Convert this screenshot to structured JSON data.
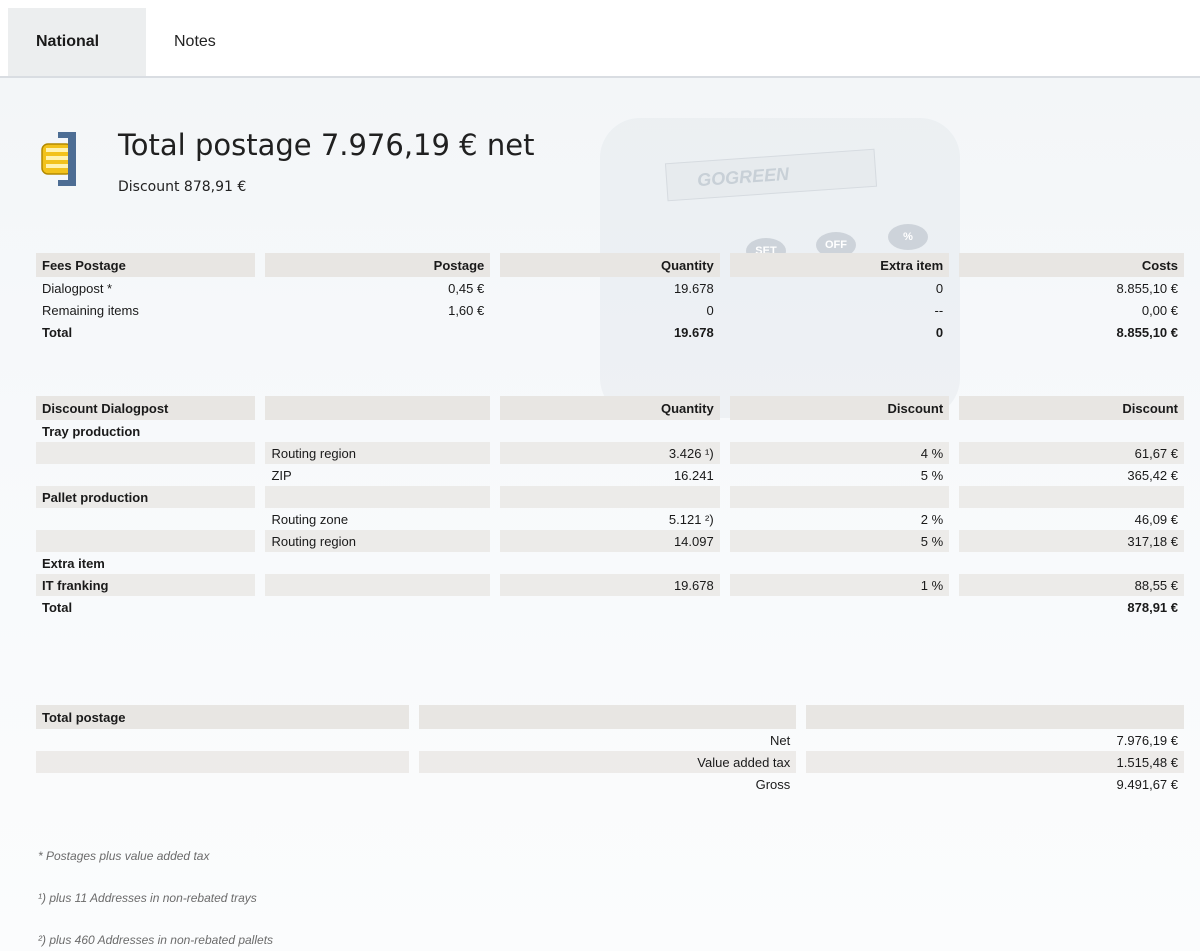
{
  "tabs": [
    {
      "label": "National",
      "active": true
    },
    {
      "label": "Notes",
      "active": false
    }
  ],
  "header": {
    "title": "Total postage 7.976,19 € net",
    "subtitle": "Discount 878,91 €"
  },
  "background": {
    "screen_text": "GOGREEN",
    "buttons": [
      "SET",
      "OFF",
      "%"
    ]
  },
  "fees": {
    "headers": [
      "Fees Postage",
      "Postage",
      "Quantity",
      "Extra item",
      "Costs"
    ],
    "rows": [
      [
        "Dialogpost *",
        "0,45 €",
        "19.678",
        "0",
        "8.855,10 €"
      ],
      [
        "Remaining items",
        "1,60 €",
        "0",
        "--",
        "0,00 €"
      ]
    ],
    "total": [
      "Total",
      "",
      "19.678",
      "0",
      "8.855,10 €"
    ]
  },
  "discount": {
    "headers": [
      "Discount Dialogpost",
      "",
      "Quantity",
      "Discount",
      "Discount"
    ],
    "rows": [
      [
        "Tray production",
        "",
        "",
        "",
        ""
      ],
      [
        "",
        "Routing region",
        "3.426 ¹)",
        "4 %",
        "61,67 €"
      ],
      [
        "",
        "ZIP",
        "16.241",
        "5 %",
        "365,42 €"
      ],
      [
        "Pallet production",
        "",
        "",
        "",
        ""
      ],
      [
        "",
        "Routing zone",
        "5.121 ²)",
        "2 %",
        "46,09 €"
      ],
      [
        "",
        "Routing region",
        "14.097",
        "5 %",
        "317,18 €"
      ],
      [
        "Extra item",
        "",
        "",
        "",
        ""
      ],
      [
        "IT franking",
        "",
        "19.678",
        "1 %",
        "88,55 €"
      ]
    ],
    "total": [
      "Total",
      "",
      "",
      "",
      "878,91 €"
    ]
  },
  "total_postage": {
    "header": "Total postage",
    "rows": [
      [
        "Net",
        "7.976,19 €"
      ],
      [
        "Value added tax",
        "1.515,48 €"
      ],
      [
        "Gross",
        "9.491,67 €"
      ]
    ]
  },
  "footnotes": [
    "* Postages plus value added tax",
    "¹) plus 11 Addresses in non-rebated trays",
    "²) plus 460 Addresses in non-rebated pallets"
  ]
}
